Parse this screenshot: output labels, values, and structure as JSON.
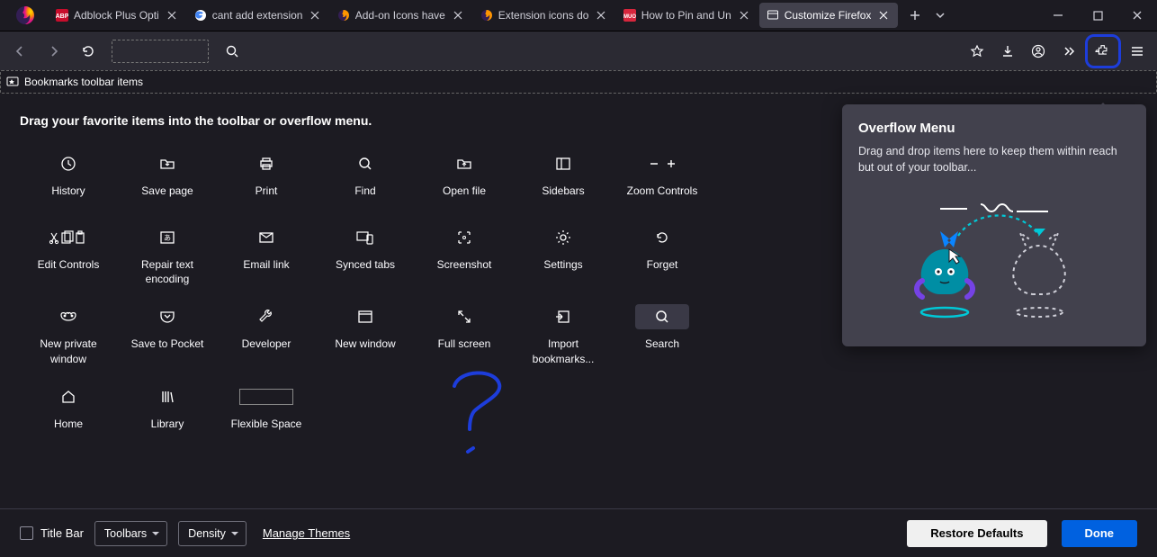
{
  "tabs": [
    {
      "title": "Adblock Plus Opti",
      "favicon": "abp"
    },
    {
      "title": "cant add extension",
      "favicon": "google"
    },
    {
      "title": "Add-on Icons have",
      "favicon": "firefox"
    },
    {
      "title": "Extension icons do",
      "favicon": "firefox"
    },
    {
      "title": "How to Pin and Un",
      "favicon": "muo"
    },
    {
      "title": "Customize Firefox",
      "favicon": "customize",
      "active": true
    }
  ],
  "bookmarks_label": "Bookmarks toolbar items",
  "instruction": "Drag your favorite items into the toolbar or overflow menu.",
  "items": {
    "r0": [
      {
        "label": "History",
        "icon": "clock"
      },
      {
        "label": "Save page",
        "icon": "folder-down"
      },
      {
        "label": "Print",
        "icon": "print"
      },
      {
        "label": "Find",
        "icon": "search"
      },
      {
        "label": "Open file",
        "icon": "folder-up"
      },
      {
        "label": "Sidebars",
        "icon": "sidebar"
      },
      {
        "label": "Zoom Controls",
        "icon": "zoom"
      }
    ],
    "r1": [
      {
        "label": "Edit Controls",
        "icon": "cutcopy"
      },
      {
        "label": "Repair text encoding",
        "icon": "encoding"
      },
      {
        "label": "Email link",
        "icon": "mail"
      },
      {
        "label": "Synced tabs",
        "icon": "synced"
      },
      {
        "label": "Screenshot",
        "icon": "screenshot"
      },
      {
        "label": "Settings",
        "icon": "gear"
      },
      {
        "label": "Forget",
        "icon": "forget"
      }
    ],
    "r2": [
      {
        "label": "New private window",
        "icon": "mask"
      },
      {
        "label": "Save to Pocket",
        "icon": "pocket"
      },
      {
        "label": "Developer",
        "icon": "wrench"
      },
      {
        "label": "New window",
        "icon": "window"
      },
      {
        "label": "Full screen",
        "icon": "fullscreen"
      },
      {
        "label": "Import bookmarks...",
        "icon": "import"
      },
      {
        "label": "Search",
        "icon": "search",
        "highlighted": true
      }
    ],
    "r3": [
      {
        "label": "Home",
        "icon": "home"
      },
      {
        "label": "Library",
        "icon": "library"
      },
      {
        "label": "Flexible Space",
        "icon": "flexspace"
      }
    ]
  },
  "overflow": {
    "title": "Overflow Menu",
    "desc": "Drag and drop items here to keep them within reach but out of your toolbar..."
  },
  "footer": {
    "titlebar": "Title Bar",
    "toolbars": "Toolbars",
    "density": "Density",
    "themes": "Manage Themes",
    "restore": "Restore Defaults",
    "done": "Done"
  }
}
